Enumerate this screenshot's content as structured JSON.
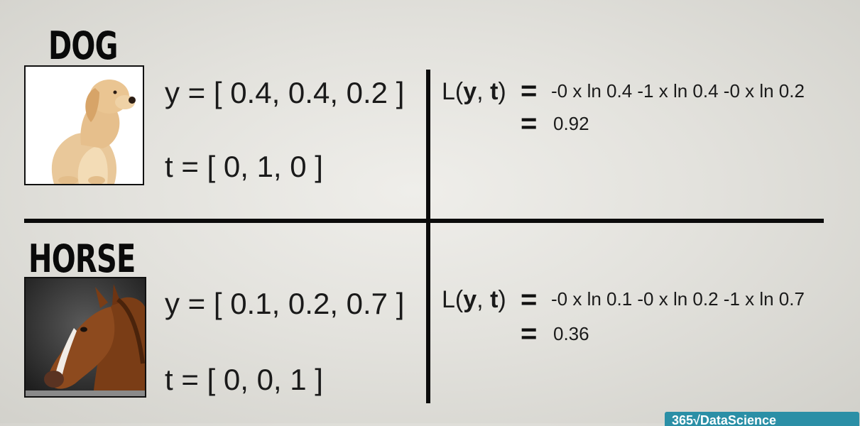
{
  "dog": {
    "title": "DOG",
    "y": "y = [ 0.4, 0.4, 0.2 ]",
    "t": "t = [ 0, 1, 0 ]",
    "loss_prefix": "L(",
    "loss_y": "y",
    "loss_sep": ", ",
    "loss_t": "t",
    "loss_suffix": ")",
    "eq1": "=",
    "expr1": "-0 x ln 0.4  -1 x ln 0.4  -0 x ln 0.2",
    "eq2": "=",
    "result": "0.92"
  },
  "horse": {
    "title": "HORSE",
    "y": "y = [ 0.1, 0.2, 0.7 ]",
    "t": "t = [ 0, 0, 1 ]",
    "loss_prefix": "L(",
    "loss_y": "y",
    "loss_sep": ", ",
    "loss_t": "t",
    "loss_suffix": ")",
    "eq1": "=",
    "expr1": "-0 x ln 0.1  -0 x ln 0.2  -1 x ln 0.7",
    "eq2": "=",
    "result": "0.36"
  },
  "badge": {
    "text": "365√DataScience"
  },
  "colors": {
    "divider": "#0b0b0b",
    "badge_bg": "#2b8fa6"
  }
}
